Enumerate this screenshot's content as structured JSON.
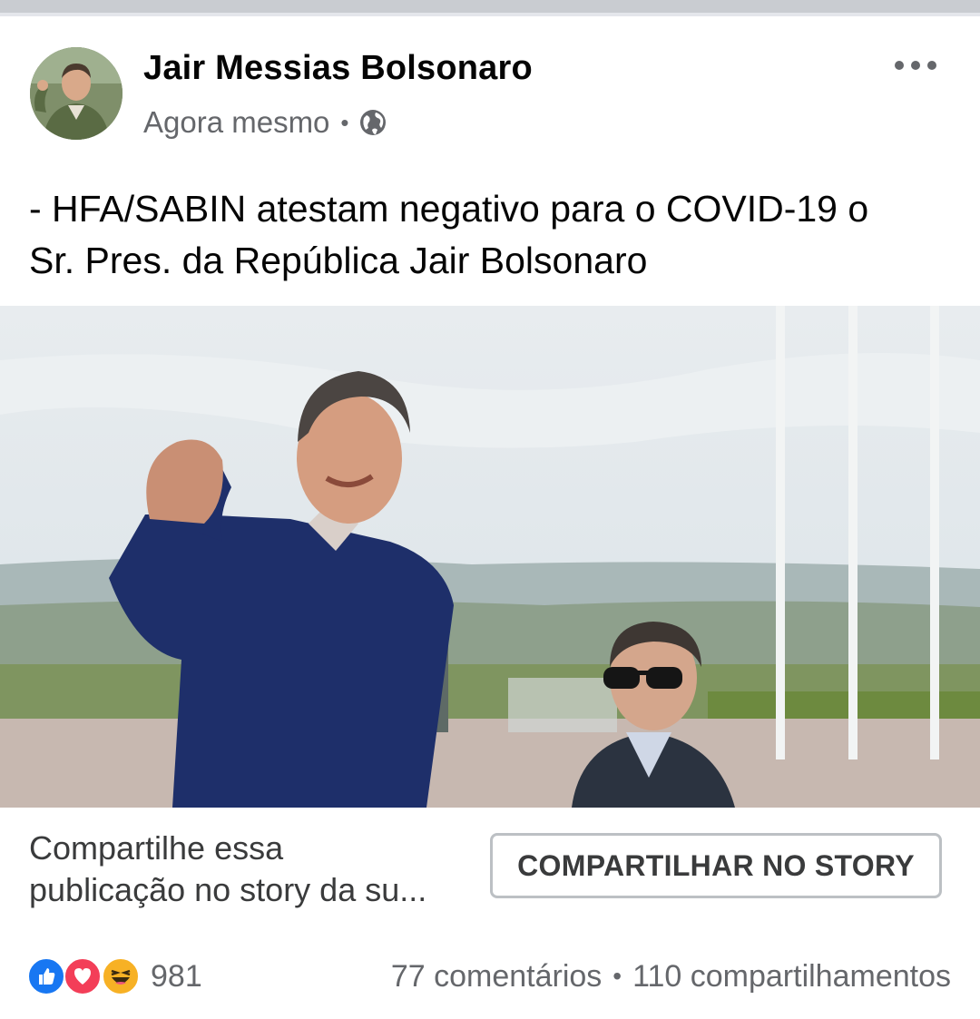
{
  "post": {
    "author": "Jair Messias Bolsonaro",
    "timestamp": "Agora mesmo",
    "separator": "•",
    "privacy_icon": "globe-icon",
    "more_icon": "more-options-icon",
    "text_line1": "- HFA/SABIN atestam negativo para o COVID-19 o",
    "text_line2": "Sr. Pres. da República Jair Bolsonaro"
  },
  "share": {
    "prompt_line1": "Compartilhe essa",
    "prompt_line2": "publicação no story da su...",
    "button_label": "COMPARTILHAR NO STORY"
  },
  "engagement": {
    "reaction_icons": [
      "like-icon",
      "love-icon",
      "haha-icon"
    ],
    "reaction_count": "981",
    "comments": "77 comentários",
    "separator": "•",
    "shares": "110 compartilhamentos"
  },
  "colors": {
    "like": "#1877f2",
    "love": "#f33e58",
    "haha": "#f7b125",
    "secondary_text": "#65676b",
    "primary_text": "#050505"
  }
}
